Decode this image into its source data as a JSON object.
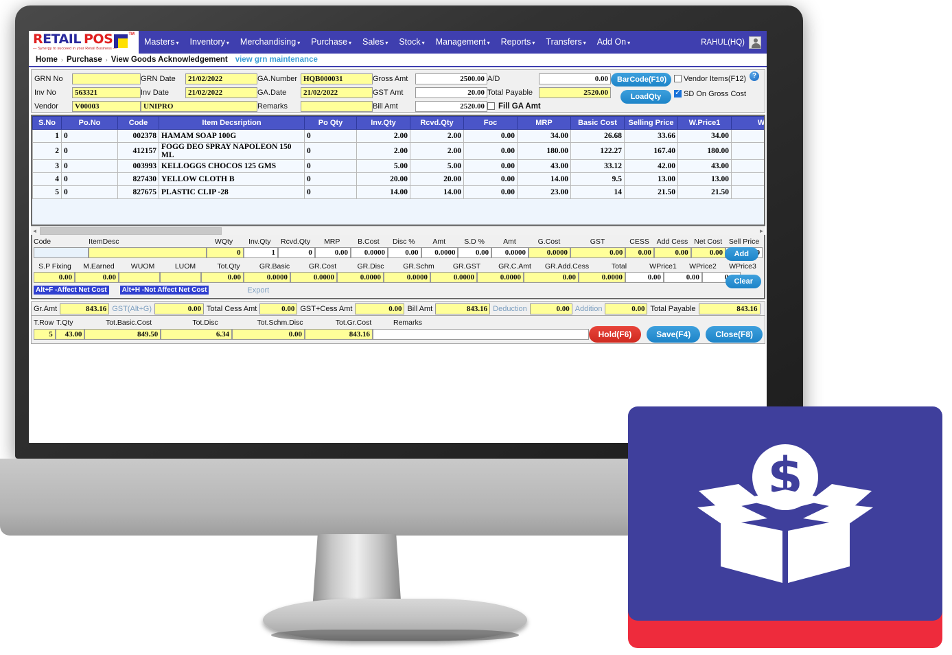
{
  "brand": {
    "logo_r": "R",
    "logo_etail": "ETAIL",
    "logo_pos": "POS",
    "logo_tm": "TM",
    "tagline": "— Synergy to succeed in your Retail Business —"
  },
  "topnav": {
    "items": [
      {
        "label": "Masters",
        "caret": "▾"
      },
      {
        "label": "Inventory",
        "caret": "▾"
      },
      {
        "label": "Merchandising",
        "caret": "▾"
      },
      {
        "label": "Purchase",
        "caret": "▾"
      },
      {
        "label": "Sales",
        "caret": "▾"
      },
      {
        "label": "Stock",
        "caret": "▾"
      },
      {
        "label": "Management",
        "caret": "▾"
      },
      {
        "label": "Reports",
        "caret": "▾"
      },
      {
        "label": "Transfers",
        "caret": "▾"
      },
      {
        "label": "Add On",
        "caret": "▾"
      }
    ],
    "user": "RAHUL(HQ)"
  },
  "breadcrumb": {
    "home": "Home",
    "sep": "›",
    "section": "Purchase",
    "page": "View Goods Acknowledgement",
    "sublink": "view grn maintenance",
    "help": "?"
  },
  "header_form": {
    "grn_no_label": "GRN No",
    "grn_no_value": "",
    "inv_no_label": "Inv No",
    "inv_no_value": "563321",
    "vendor_label": "Vendor",
    "vendor_code_value": "V00003",
    "vendor_name_value": "UNIPRO",
    "grn_date_label": "GRN Date",
    "grn_date_value": "21/02/2022",
    "inv_date_label": "Inv Date",
    "inv_date_value": "21/02/2022",
    "remarks_label": "Remarks",
    "remarks_value": "",
    "ga_number_label": "GA.Number",
    "ga_number_value": "HQB000031",
    "ga_date_label": "GA.Date",
    "ga_date_value": "21/02/2022",
    "gross_amt_label": "Gross Amt",
    "gross_amt_value": "2500.00",
    "gst_amt_label": "GST Amt",
    "gst_amt_value": "20.00",
    "bill_amt_label": "Bill Amt",
    "bill_amt_value": "2520.00",
    "ad_label": "A/D",
    "ad_value": "0.00",
    "total_payable_label": "Total Payable",
    "total_payable_value": "2520.00",
    "fill_ga_amt_label": "Fill GA Amt",
    "fill_ga_amt_checked": false,
    "barcode_btn": "BarCode(F10)",
    "loadqty_btn": "LoadQty",
    "vendor_items_label": "Vendor Items(F12)",
    "vendor_items_checked": false,
    "sd_on_gross_label": "SD On Gross Cost",
    "sd_on_gross_checked": true
  },
  "grid": {
    "columns": [
      "S.No",
      "Po.No",
      "Code",
      "Item Decsription",
      "Po Qty",
      "Inv.Qty",
      "Rcvd.Qty",
      "Foc",
      "MRP",
      "Basic Cost",
      "Selling Price",
      "W.Price1",
      "W.P"
    ],
    "rows": [
      {
        "sno": "1",
        "pono": "0",
        "code": "002378",
        "desc": "HAMAM SOAP 100G",
        "poqty": "0",
        "invqty": "2.00",
        "rcvdqty": "2.00",
        "foc": "0.00",
        "mrp": "34.00",
        "basic": "26.68",
        "sell": "33.66",
        "wp1": "34.00",
        "wp2": ""
      },
      {
        "sno": "2",
        "pono": "0",
        "code": "412157",
        "desc": "FOGG DEO SPRAY NAPOLEON 150 ML",
        "poqty": "0",
        "invqty": "2.00",
        "rcvdqty": "2.00",
        "foc": "0.00",
        "mrp": "180.00",
        "basic": "122.27",
        "sell": "167.40",
        "wp1": "180.00",
        "wp2": ""
      },
      {
        "sno": "3",
        "pono": "0",
        "code": "003993",
        "desc": "KELLOGGS CHOCOS 125 GMS",
        "poqty": "0",
        "invqty": "5.00",
        "rcvdqty": "5.00",
        "foc": "0.00",
        "mrp": "43.00",
        "basic": "33.12",
        "sell": "42.00",
        "wp1": "43.00",
        "wp2": ""
      },
      {
        "sno": "4",
        "pono": "0",
        "code": "827430",
        "desc": "YELLOW CLOTH B",
        "poqty": "0",
        "invqty": "20.00",
        "rcvdqty": "20.00",
        "foc": "0.00",
        "mrp": "14.00",
        "basic": "9.5",
        "sell": "13.00",
        "wp1": "13.00",
        "wp2": ""
      },
      {
        "sno": "5",
        "pono": "0",
        "code": "827675",
        "desc": "PLASTIC CLIP -28",
        "poqty": "0",
        "invqty": "14.00",
        "rcvdqty": "14.00",
        "foc": "0.00",
        "mrp": "23.00",
        "basic": "14",
        "sell": "21.50",
        "wp1": "21.50",
        "wp2": ""
      }
    ]
  },
  "entry": {
    "line1_labels": [
      "Code",
      "ItemDesc",
      "WQty",
      "Inv.Qty",
      "Rcvd.Qty",
      "MRP",
      "B.Cost",
      "Disc %",
      "Amt",
      "S.D %",
      "Amt",
      "G.Cost",
      "GST",
      "CESS",
      "Add Cess",
      "Net Cost",
      "Sell Price"
    ],
    "line1_values": [
      "",
      "",
      "0",
      "1",
      "0",
      "0.00",
      "0.0000",
      "0.00",
      "0.0000",
      "0.00",
      "0.0000",
      "0.0000",
      "0.00",
      "0.00",
      "0.00",
      "0.00",
      "0.00"
    ],
    "line2_labels": [
      "S.P Fixing",
      "M.Earned",
      "WUOM",
      "LUOM",
      "Tot.Qty",
      "GR.Basic",
      "GR.Cost",
      "GR.Disc",
      "GR.Schm",
      "GR.GST",
      "GR.C.Amt",
      "GR.Add.Cess",
      "Total",
      "WPrice1",
      "WPrice2",
      "WPrice3"
    ],
    "line2_values": [
      "0.00",
      "0.00",
      "",
      "",
      "0.00",
      "0.0000",
      "0.0000",
      "0.0000",
      "0.0000",
      "0.0000",
      "0.0000",
      "0.00",
      "0.0000",
      "0.00",
      "0.00",
      "0.00"
    ],
    "hint_affect": "Alt+F -Affect Net Cost",
    "hint_not_affect": "Alt+H -Not Affect Net Cost",
    "export_link": "Export",
    "add_btn": "Add",
    "clear_btn": "Clear"
  },
  "totals": {
    "gr_amt_label": "Gr.Amt",
    "gr_amt_value": "843.16",
    "gst_label": "GST(Alt+G)",
    "gst_value": "0.00",
    "total_cess_label": "Total Cess Amt",
    "total_cess_value": "0.00",
    "gst_cess_label": "GST+Cess Amt",
    "gst_cess_value": "0.00",
    "bill_amt_label": "Bill Amt",
    "bill_amt_value": "843.16",
    "deduction_label": "Deduction",
    "deduction_value": "0.00",
    "addition_label": "Addition",
    "addition_value": "0.00",
    "total_payable_label": "Total Payable",
    "total_payable_value": "843.16"
  },
  "footer": {
    "trow_label": "T.Row",
    "trow_value": "5",
    "tqty_label": "T.Qty",
    "tqty_value": "43.00",
    "tot_basic_label": "Tot.Basic.Cost",
    "tot_basic_value": "849.50",
    "tot_disc_label": "Tot.Disc",
    "tot_disc_value": "6.34",
    "tot_schm_label": "Tot.Schm.Disc",
    "tot_schm_value": "0.00",
    "tot_gr_label": "Tot.Gr.Cost",
    "tot_gr_value": "843.16",
    "remarks_label": "Remarks",
    "remarks_value": "",
    "hold_btn": "Hold(F6)",
    "save_btn": "Save(F4)",
    "close_btn": "Close(F8)"
  },
  "promo": {
    "icon": "box-with-dollar-coin-icon",
    "card_color": "#3f3f9c",
    "accent_color": "#ee2b3c"
  }
}
